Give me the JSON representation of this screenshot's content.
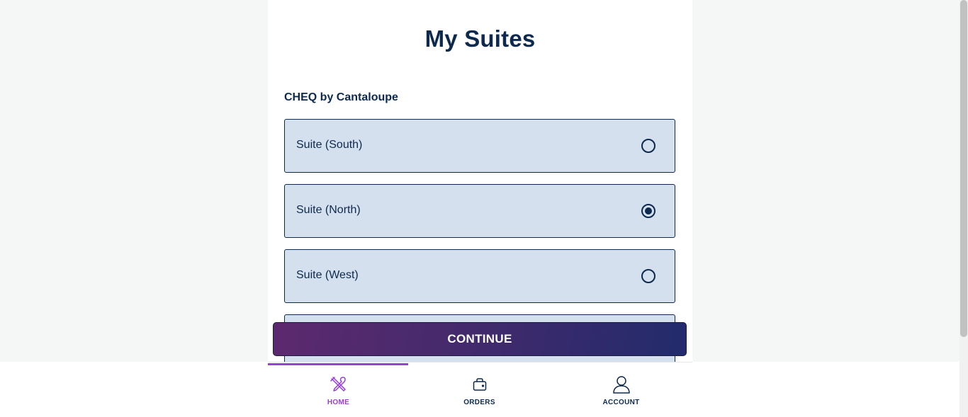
{
  "page": {
    "title": "My Suites",
    "venue": "CHEQ by Cantaloupe"
  },
  "suites": [
    {
      "label": "Suite (South)",
      "selected": false
    },
    {
      "label": "Suite (North)",
      "selected": true
    },
    {
      "label": "Suite (West)",
      "selected": false
    }
  ],
  "actions": {
    "continue_label": "CONTINUE"
  },
  "nav": {
    "items": [
      {
        "label": "HOME",
        "icon": "utensils-icon",
        "active": true
      },
      {
        "label": "ORDERS",
        "icon": "bag-icon",
        "active": false
      },
      {
        "label": "ACCOUNT",
        "icon": "user-icon",
        "active": false
      }
    ]
  },
  "colors": {
    "primary": "#0d2a4e",
    "accent": "#9b3ed9",
    "option_bg": "#d5e0ee",
    "button_gradient_start": "#5d296e",
    "button_gradient_end": "#222b6c"
  }
}
